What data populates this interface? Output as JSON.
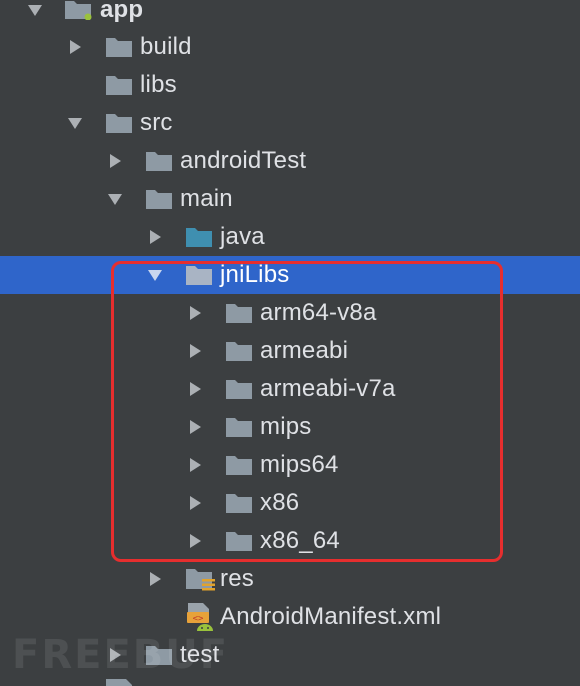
{
  "tree": {
    "items": [
      {
        "label": "app",
        "icon": "module-folder-icon",
        "expanded": true
      },
      {
        "label": "build",
        "icon": "folder-icon",
        "expanded": false
      },
      {
        "label": "libs",
        "icon": "folder-icon"
      },
      {
        "label": "src",
        "icon": "folder-icon",
        "expanded": true
      },
      {
        "label": "androidTest",
        "icon": "folder-icon",
        "expanded": false
      },
      {
        "label": "main",
        "icon": "folder-icon",
        "expanded": true
      },
      {
        "label": "java",
        "icon": "source-folder-icon",
        "expanded": false
      },
      {
        "label": "jniLibs",
        "icon": "folder-icon",
        "expanded": true,
        "selected": true
      },
      {
        "label": "arm64-v8a",
        "icon": "folder-icon",
        "expanded": false
      },
      {
        "label": "armeabi",
        "icon": "folder-icon",
        "expanded": false
      },
      {
        "label": "armeabi-v7a",
        "icon": "folder-icon",
        "expanded": false
      },
      {
        "label": "mips",
        "icon": "folder-icon",
        "expanded": false
      },
      {
        "label": "mips64",
        "icon": "folder-icon",
        "expanded": false
      },
      {
        "label": "x86",
        "icon": "folder-icon",
        "expanded": false
      },
      {
        "label": "x86_64",
        "icon": "folder-icon",
        "expanded": false
      },
      {
        "label": "res",
        "icon": "resource-folder-icon",
        "expanded": false
      },
      {
        "label": "AndroidManifest.xml",
        "icon": "android-manifest-icon"
      },
      {
        "label": "test",
        "icon": "folder-icon",
        "expanded": false
      }
    ]
  },
  "colors": {
    "background": "#3c3f41",
    "selection": "#2f65ca",
    "folder": "#8e9aa4",
    "source_folder": "#3f8fb0",
    "highlight": "#e62e2e"
  },
  "watermark": "FREEBUF"
}
